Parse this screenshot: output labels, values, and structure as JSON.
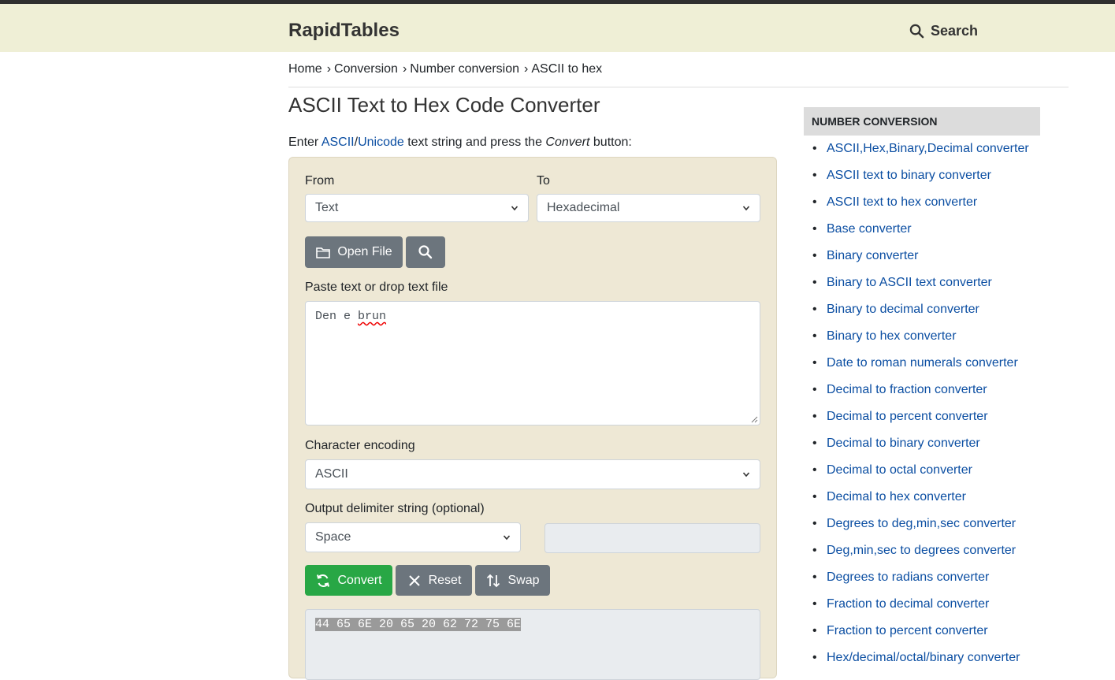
{
  "site": {
    "logo": "RapidTables",
    "search_label": "Search"
  },
  "breadcrumb": [
    "Home",
    "Conversion",
    "Number conversion",
    "ASCII to hex"
  ],
  "breadcrumb_sep": "›",
  "page": {
    "title": "ASCII Text to Hex Code Converter",
    "intro": {
      "prefix": "Enter ",
      "link1": "ASCII",
      "slash": "/",
      "link2": "Unicode",
      "middle": " text string and press the ",
      "emph": "Convert",
      "suffix": " button:"
    }
  },
  "form": {
    "from_label": "From",
    "from_value": "Text",
    "to_label": "To",
    "to_value": "Hexadecimal",
    "open_file": "Open File",
    "input_label": "Paste text or drop text file",
    "input_text": {
      "part1": "Den e ",
      "part2": "brun"
    },
    "encoding_label": "Character encoding",
    "encoding_value": "ASCII",
    "delimiter_label": "Output delimiter string (optional)",
    "delimiter_value": "Space",
    "delimiter_custom": "",
    "convert": "Convert",
    "reset": "Reset",
    "swap": "Swap",
    "output": "44 65 6E 20 65 20 62 72 75 6E"
  },
  "sidebar": {
    "title": "NUMBER CONVERSION",
    "items": [
      "ASCII,Hex,Binary,Decimal converter",
      "ASCII text to binary converter",
      "ASCII text to hex converter",
      "Base converter",
      "Binary converter",
      "Binary to ASCII text converter",
      "Binary to decimal converter",
      "Binary to hex converter",
      "Date to roman numerals converter",
      "Decimal to fraction converter",
      "Decimal to percent converter",
      "Decimal to binary converter",
      "Decimal to octal converter",
      "Decimal to hex converter",
      "Degrees to deg,min,sec converter",
      "Deg,min,sec to degrees converter",
      "Degrees to radians converter",
      "Fraction to decimal converter",
      "Fraction to percent converter",
      "Hex/decimal/octal/binary converter"
    ]
  },
  "colors": {
    "header_bg": "#efefd6",
    "panel_bg": "#eee8d5",
    "link": "#0b4ea2",
    "convert_green": "#28a745",
    "button_gray": "#6c757d"
  },
  "icons": {
    "search": "search-icon",
    "folder": "folder-icon",
    "convert": "refresh-icon",
    "reset": "close-icon",
    "swap": "swap-icon"
  }
}
